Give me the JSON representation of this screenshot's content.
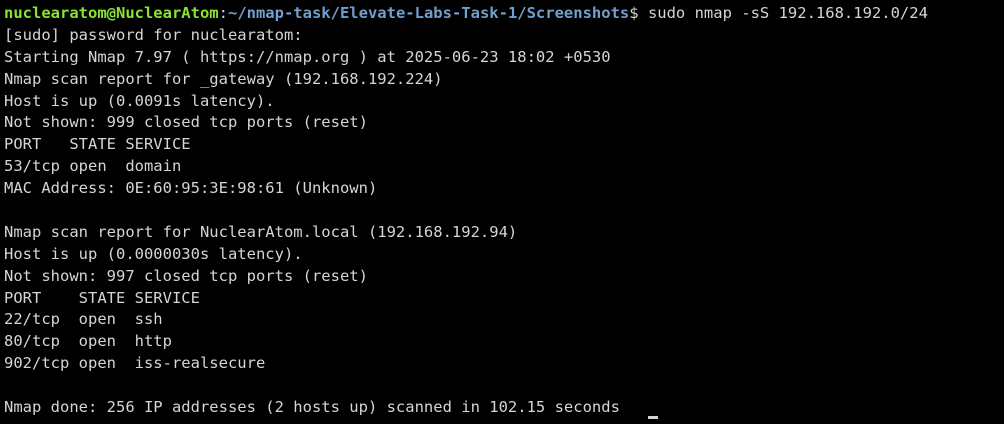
{
  "prompt": {
    "user_host": "nuclearatom@NuclearAtom",
    "separator": ":",
    "path": "~/nmap-task/Elevate-Labs-Task-1/Screenshots",
    "symbol": "$",
    "command": " sudo nmap -sS 192.168.192.0/24"
  },
  "output": {
    "l1": "[sudo] password for nuclearatom:",
    "l2": "Starting Nmap 7.97 ( https://nmap.org ) at 2025-06-23 18:02 +0530",
    "l3": "Nmap scan report for _gateway (192.168.192.224)",
    "l4": "Host is up (0.0091s latency).",
    "l5": "Not shown: 999 closed tcp ports (reset)",
    "l6": "PORT   STATE SERVICE",
    "l7": "53/tcp open  domain",
    "l8": "MAC Address: 0E:60:95:3E:98:61 (Unknown)",
    "l9": "",
    "l10": "Nmap scan report for NuclearAtom.local (192.168.192.94)",
    "l11": "Host is up (0.0000030s latency).",
    "l12": "Not shown: 997 closed tcp ports (reset)",
    "l13": "PORT    STATE SERVICE",
    "l14": "22/tcp  open  ssh",
    "l15": "80/tcp  open  http",
    "l16": "902/tcp open  iss-realsecure",
    "l17": "",
    "l18": "Nmap done: 256 IP addresses (2 hosts up) scanned in 102.15 seconds"
  },
  "colors": {
    "background": "#000000",
    "text": "#d3d7cf",
    "user_host": "#8ae234",
    "path": "#729fcf"
  }
}
